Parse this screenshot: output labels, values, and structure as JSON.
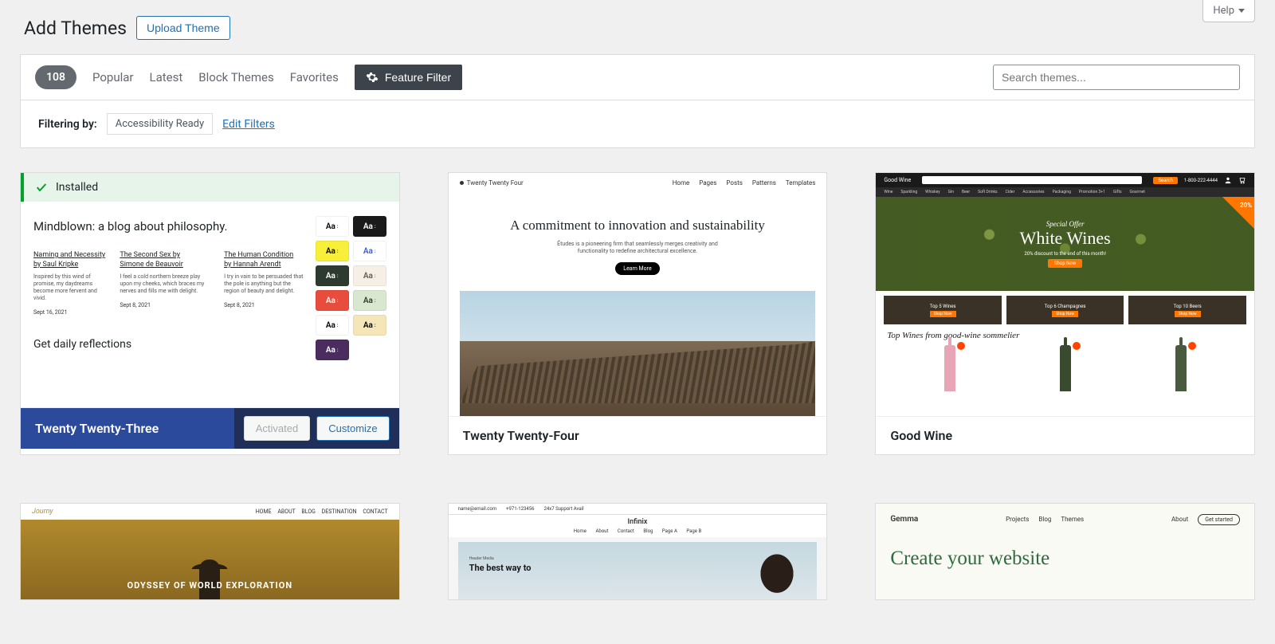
{
  "header": {
    "title": "Add Themes",
    "upload_label": "Upload Theme",
    "help_label": "Help"
  },
  "filter": {
    "count": "108",
    "tabs": {
      "popular": "Popular",
      "latest": "Latest",
      "block": "Block Themes",
      "favorites": "Favorites"
    },
    "feature_filter_label": "Feature Filter",
    "search_placeholder": "Search themes...",
    "filtering_by_label": "Filtering by:",
    "tags": [
      "Accessibility Ready"
    ],
    "edit_filters_label": "Edit Filters"
  },
  "themes": [
    {
      "name": "Twenty Twenty-Three",
      "installed_label": "Installed",
      "activated_label": "Activated",
      "customize_label": "Customize",
      "preview": {
        "heading": "Mindblown: a blog about philosophy.",
        "reflections": "Get daily reflections",
        "cols": [
          {
            "title": "Naming and Necessity",
            "author": "by Saul Kripke",
            "blurb": "Inspired by this wind of promise, my daydreams become more fervent and vivid.",
            "date": "Sept 16, 2021"
          },
          {
            "title": "The Second Sex by",
            "author": "Simone de Beauvoir",
            "blurb": "I feel a cold northern breeze play upon my cheeks, which braces my nerves and fills me with delight.",
            "date": "Sept 8, 2021"
          },
          {
            "title": "The Human Condition",
            "author": "by Hannah Arendt",
            "blurb": "I try in vain to be persuaded that the pole is anything but the region of beauty and delight.",
            "date": "Sept 8, 2021"
          }
        ],
        "swatches": [
          {
            "bg": "#ffffff",
            "fg": "#000"
          },
          {
            "bg": "#1a1a1a",
            "fg": "#fff"
          },
          {
            "bg": "#f7ef3a",
            "fg": "#000"
          },
          {
            "bg": "#ffffff",
            "fg": "#3858e9"
          },
          {
            "bg": "#2d3a2e",
            "fg": "#fff"
          },
          {
            "bg": "#f5efe6",
            "fg": "#6b5b4b"
          },
          {
            "bg": "#e74c3c",
            "fg": "#fff"
          },
          {
            "bg": "#d9e6d0",
            "fg": "#2d3a2e"
          },
          {
            "bg": "#ffffff",
            "fg": "#000"
          },
          {
            "bg": "#f5e6b8",
            "fg": "#000"
          },
          {
            "bg": "#4a2d5e",
            "fg": "#fff"
          }
        ]
      }
    },
    {
      "name": "Twenty Twenty-Four",
      "preview": {
        "brand": "Twenty Twenty Four",
        "nav": [
          "Home",
          "Pages",
          "Posts",
          "Patterns",
          "Templates"
        ],
        "heading": "A commitment to innovation and sustainability",
        "sub": "Études is a pioneering firm that seamlessly merges creativity and functionality to redefine architectural excellence.",
        "cta": "Learn More"
      }
    },
    {
      "name": "Good Wine",
      "preview": {
        "brand": "Good Wine",
        "search_btn": "Search",
        "phone": "1-800-222-4444",
        "nav": [
          "Wine",
          "Sparkling",
          "Whiskey",
          "Gin",
          "Beer",
          "Soft Drinks",
          "Cider",
          "Accessories",
          "Packaging",
          "Promotion 3+1",
          "Gifts",
          "Gourmet"
        ],
        "offer": "Special Offer",
        "hero_title": "White Wines",
        "discount_text": "20% discount to the end of this month!",
        "corner": "20%",
        "shop_now": "Shop Now",
        "tiles": [
          "Top 5 Wines",
          "Top 6 Champagnes",
          "Top 10 Beers"
        ],
        "sommelier": "Top Wines from good-wine sommelier"
      }
    },
    {
      "name_hidden": "Journy",
      "preview": {
        "brand": "Journy",
        "nav": [
          "HOME",
          "ABOUT",
          "BLOG",
          "DESTINATION",
          "CONTACT"
        ],
        "hero": "ODYSSEY OF WORLD EXPLORATION"
      }
    },
    {
      "name_hidden": "Infinix",
      "preview": {
        "top": [
          "name@email.com",
          "+971-123456",
          "24x7 Support Avail"
        ],
        "brand": "Infinix",
        "nav": [
          "Home",
          "About",
          "Contact",
          "Blog",
          "Page A",
          "Page B"
        ],
        "tag": "Header Media",
        "hero": "The best way to"
      }
    },
    {
      "name_hidden": "Gemma",
      "preview": {
        "brand": "Gemma",
        "mid": [
          "Projects",
          "Blog",
          "Themes"
        ],
        "about": "About",
        "get_started": "Get started",
        "hero": "Create your website"
      }
    }
  ]
}
